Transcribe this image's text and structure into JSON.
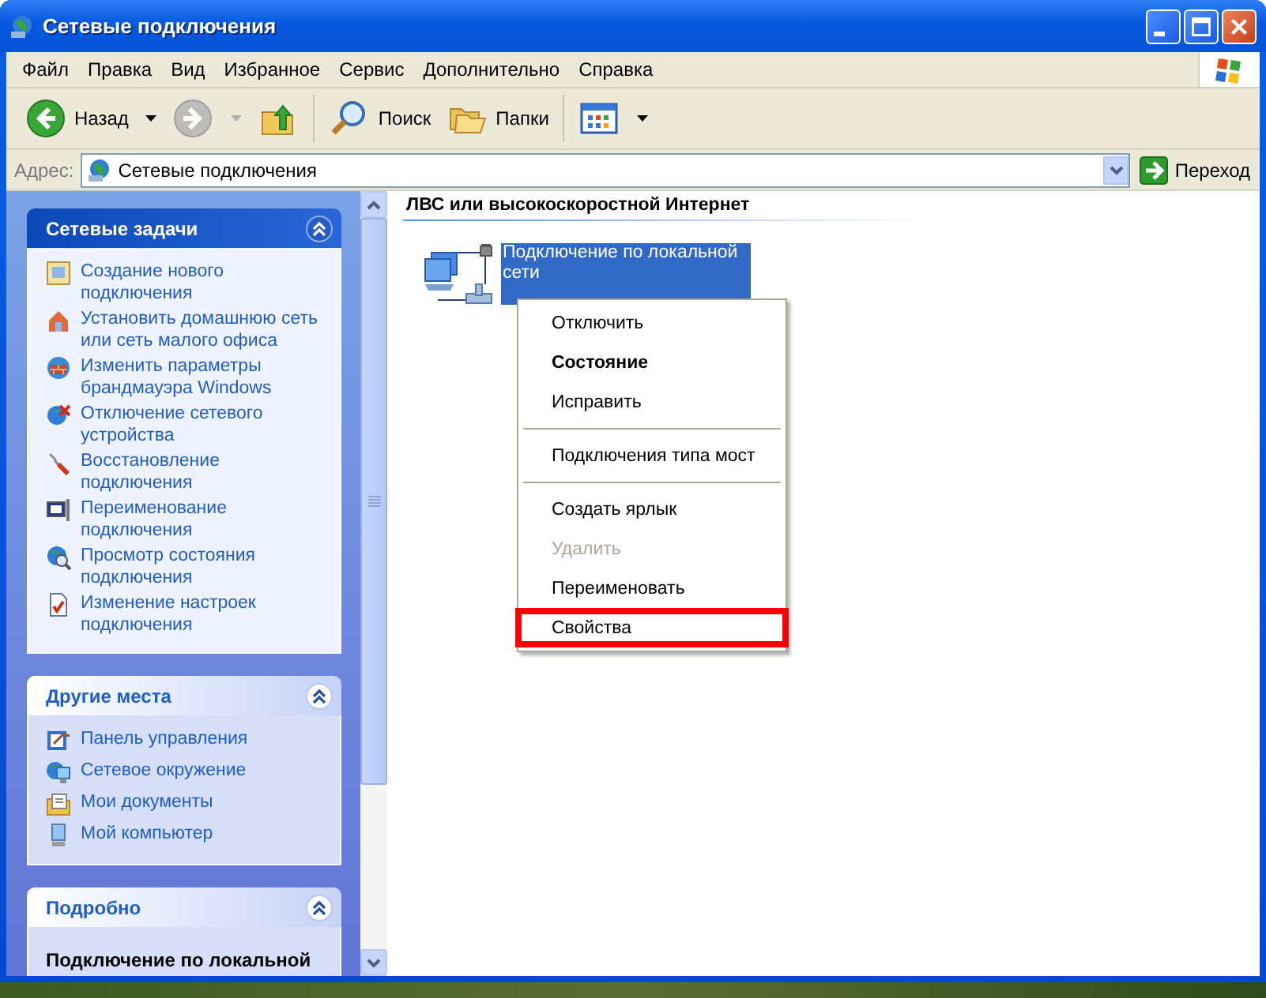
{
  "window": {
    "title": "Сетевые подключения"
  },
  "menu_bar": [
    "Файл",
    "Правка",
    "Вид",
    "Избранное",
    "Сервис",
    "Дополнительно",
    "Справка"
  ],
  "toolbar": [
    {
      "kind": "back",
      "label": "Назад",
      "disabled": false
    },
    {
      "kind": "forward",
      "disabled": true
    },
    {
      "kind": "up",
      "disabled": false
    },
    {
      "kind": "search",
      "label": "Поиск",
      "disabled": false
    },
    {
      "kind": "folders",
      "label": "Папки",
      "disabled": false
    },
    {
      "kind": "views",
      "disabled": false
    }
  ],
  "address_bar": {
    "label": "Адрес:",
    "value": "Сетевые подключения",
    "go_button": "Переход"
  },
  "task_panes": [
    {
      "title": "Сетевые задачи",
      "kind": "special",
      "items": [
        {
          "kind": "new",
          "label": "Создание нового подключения"
        },
        {
          "kind": "home",
          "label": "Установить домашнюю сеть или сеть малого офиса"
        },
        {
          "kind": "firewall",
          "label": "Изменить параметры брандмауэра Windows"
        },
        {
          "kind": "disable",
          "label": "Отключение сетевого устройства"
        },
        {
          "kind": "repair",
          "label": "Восстановление подключения"
        },
        {
          "kind": "rename",
          "label": "Переименование подключения"
        },
        {
          "kind": "status",
          "label": "Просмотр состояния подключения"
        },
        {
          "kind": "settings",
          "label": "Изменение настроек подключения"
        }
      ]
    },
    {
      "title": "Другие места",
      "kind": "normal",
      "items": [
        {
          "kind": "control",
          "label": "Панель управления"
        },
        {
          "kind": "network",
          "label": "Сетевое окружение"
        },
        {
          "kind": "documents",
          "label": "Мои документы"
        },
        {
          "kind": "computer",
          "label": "Мой компьютер"
        }
      ]
    },
    {
      "title": "Подробно",
      "kind": "details",
      "items": [
        {
          "kind": "heading",
          "label": "Подключение по локальной"
        }
      ]
    }
  ],
  "group_header": "ЛВС или высокоскоростной Интернет",
  "connection": {
    "name": "Подключение по локальной сети",
    "selected": true
  },
  "context_menu": [
    {
      "kind": "item",
      "label": "Отключить",
      "default": false,
      "disabled": false,
      "highlighted": false
    },
    {
      "kind": "item",
      "label": "Состояние",
      "default": true,
      "disabled": false,
      "highlighted": false
    },
    {
      "kind": "item",
      "label": "Исправить",
      "default": false,
      "disabled": false,
      "highlighted": false
    },
    {
      "kind": "separator"
    },
    {
      "kind": "item",
      "label": "Подключения типа мост",
      "default": false,
      "disabled": false,
      "highlighted": false
    },
    {
      "kind": "separator"
    },
    {
      "kind": "item",
      "label": "Создать ярлык",
      "default": false,
      "disabled": false,
      "highlighted": false
    },
    {
      "kind": "item",
      "label": "Удалить",
      "default": false,
      "disabled": true,
      "highlighted": false
    },
    {
      "kind": "item",
      "label": "Переименовать",
      "default": false,
      "disabled": false,
      "highlighted": false
    },
    {
      "kind": "item",
      "label": "Свойства",
      "default": false,
      "disabled": false,
      "highlighted": true
    }
  ]
}
